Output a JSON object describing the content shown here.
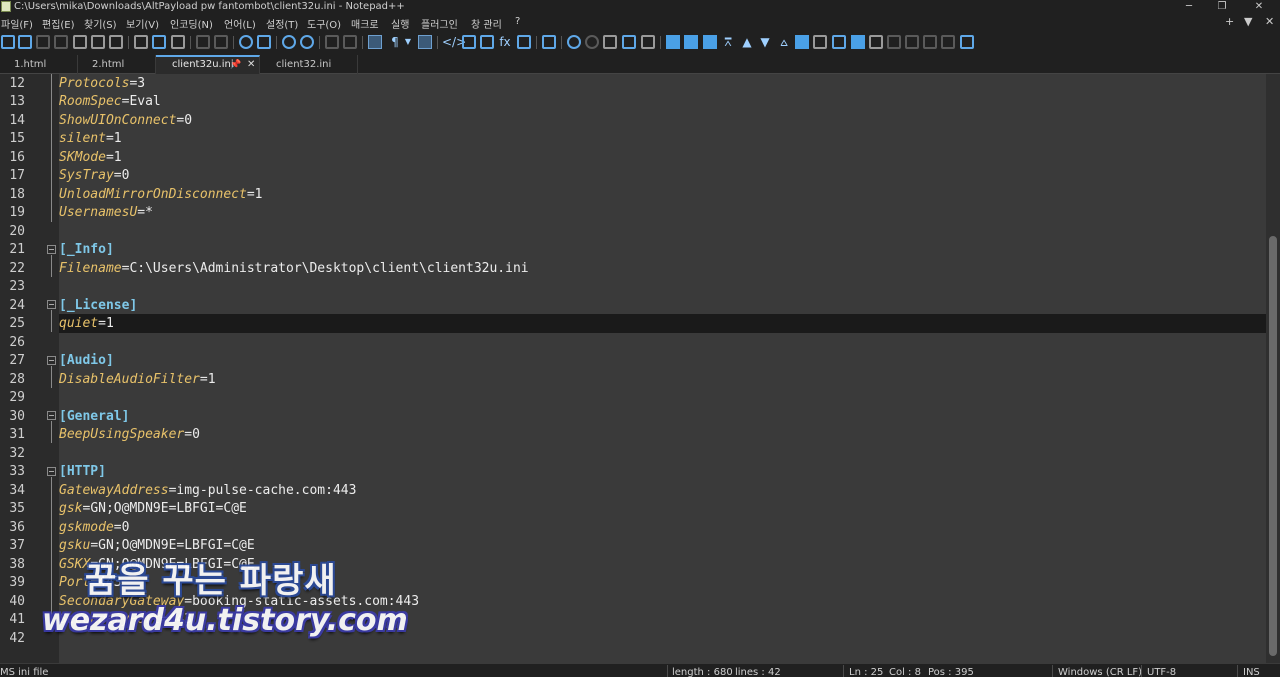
{
  "window": {
    "title": "C:\\Users\\mika\\Downloads\\AltPayload pw fantombot\\client32u.ini - Notepad++",
    "minimize": "─",
    "restore": "❐",
    "close": "✕"
  },
  "menu": {
    "items": [
      "파일(F)",
      "편집(E)",
      "찾기(S)",
      "보기(V)",
      "인코딩(N)",
      "언어(L)",
      "설정(T)",
      "도구(O)",
      "매크로",
      "실행",
      "플러그인",
      "창 관리",
      "?"
    ],
    "right_plus": "+",
    "right_arrow": "▼",
    "right_close": "✕"
  },
  "tabs": [
    {
      "label": "1.html"
    },
    {
      "label": "2.html"
    },
    {
      "label": "client32u.ini",
      "pin": "📌",
      "close": "✕"
    },
    {
      "label": "client32.ini"
    }
  ],
  "editor": {
    "lines": [
      {
        "n": "12",
        "key": "Protocols",
        "val": "3"
      },
      {
        "n": "13",
        "key": "RoomSpec",
        "val": "Eval"
      },
      {
        "n": "14",
        "key": "ShowUIOnConnect",
        "val": "0"
      },
      {
        "n": "15",
        "key": "silent",
        "val": "1"
      },
      {
        "n": "16",
        "key": "SKMode",
        "val": "1"
      },
      {
        "n": "17",
        "key": "SysTray",
        "val": "0"
      },
      {
        "n": "18",
        "key": "UnloadMirrorOnDisconnect",
        "val": "1"
      },
      {
        "n": "19",
        "key": "UsernamesU",
        "val": "*"
      },
      {
        "n": "20"
      },
      {
        "n": "21",
        "section": "[_Info]"
      },
      {
        "n": "22",
        "key": "Filename",
        "val": "C:\\Users\\Administrator\\Desktop\\client\\client32u.ini"
      },
      {
        "n": "23"
      },
      {
        "n": "24",
        "section": "[_License]"
      },
      {
        "n": "25",
        "key": "quiet",
        "val": "1"
      },
      {
        "n": "26"
      },
      {
        "n": "27",
        "section": "[Audio]"
      },
      {
        "n": "28",
        "key": "DisableAudioFilter",
        "val": "1"
      },
      {
        "n": "29"
      },
      {
        "n": "30",
        "section": "[General]"
      },
      {
        "n": "31",
        "key": "BeepUsingSpeaker",
        "val": "0"
      },
      {
        "n": "32"
      },
      {
        "n": "33",
        "section": "[HTTP]"
      },
      {
        "n": "34",
        "key": "GatewayAddress",
        "val": "img-pulse-cache.com:443"
      },
      {
        "n": "35",
        "key": "gsk",
        "val": "GN;O@MDN9E=LBFGI=C@E"
      },
      {
        "n": "36",
        "key": "gskmode",
        "val": "0"
      },
      {
        "n": "37",
        "key": "gsku",
        "val": "GN;O@MDN9E=LBFGI=C@E"
      },
      {
        "n": "38",
        "key": "GSKX",
        "val": "GN;O@MDN9E=LBFGI=C@E"
      },
      {
        "n": "39",
        "key": "Port",
        "val": "443"
      },
      {
        "n": "40",
        "key": "SecondaryGateway",
        "val": "booking-static-assets.com:443"
      },
      {
        "n": "41",
        "key": "SecondaryPort",
        "val": "443"
      },
      {
        "n": "42"
      }
    ],
    "eq": "="
  },
  "statusbar": {
    "filetype": "MS ini file",
    "length": "length : 680",
    "lines": "lines : 42",
    "ln": "Ln : 25",
    "col": "Col : 8",
    "pos": "Pos : 395",
    "eol": "Windows (CR LF)",
    "encoding": "UTF-8",
    "mode": "INS"
  },
  "watermark": {
    "line1": "꿈을 꾸는 파랑새",
    "line2": "wezard4u.tistory.com"
  }
}
